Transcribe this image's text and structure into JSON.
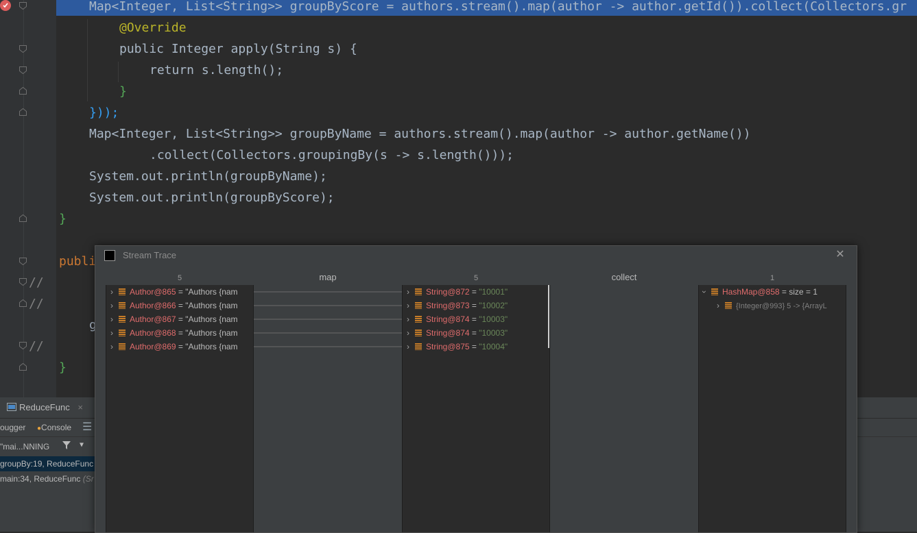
{
  "editor": {
    "lines": [
      {
        "text": "Map<Integer, List<String>> groupByScore = authors.stream().map(author -> author.getId()).collect(Collectors.gr"
      },
      {
        "text": "@Override"
      },
      {
        "text": "public Integer apply(String s) {"
      },
      {
        "text": "return s.length();"
      },
      {
        "text": "}"
      },
      {
        "text": "}));"
      },
      {
        "text": "Map<Integer, List<String>> groupByName = authors.stream().map(author -> author.getName())"
      },
      {
        "text": ".collect(Collectors.groupingBy(s -> s.length()));"
      },
      {
        "text": "System.out.println(groupByName);"
      },
      {
        "text": "System.out.println(groupByScore);"
      },
      {
        "text": "}"
      },
      {
        "text": "publi"
      },
      {
        "text": "//"
      },
      {
        "text": "//"
      },
      {
        "text": "g"
      },
      {
        "text": "//"
      },
      {
        "text": "}"
      }
    ]
  },
  "bottom": {
    "file_tab": "ReduceFunc",
    "debugger_tab": "ougger",
    "console_tab": "Console",
    "thread": "\"mai...NNING",
    "frames": [
      "groupBy:19, ReduceFunc",
      "main:34, ReduceFunc"
    ],
    "frame2_suffix": "(Sr"
  },
  "stream_trace": {
    "title": "Stream Trace",
    "columns": [
      {
        "count": "5",
        "label": ""
      },
      {
        "count": "",
        "label": "map"
      },
      {
        "count": "5",
        "label": ""
      },
      {
        "count": "",
        "label": "collect"
      },
      {
        "count": "1",
        "label": ""
      }
    ],
    "authors": [
      {
        "name": "Author@865",
        "value": "\"Authors {nam"
      },
      {
        "name": "Author@866",
        "value": "\"Authors {nam"
      },
      {
        "name": "Author@867",
        "value": "\"Authors {nam"
      },
      {
        "name": "Author@868",
        "value": "\"Authors {nam"
      },
      {
        "name": "Author@869",
        "value": "\"Authors {nam"
      }
    ],
    "strings": [
      {
        "name": "String@872",
        "value": "\"10001\""
      },
      {
        "name": "String@873",
        "value": "\"10002\""
      },
      {
        "name": "String@874",
        "value": "\"10003\""
      },
      {
        "name": "String@874",
        "value": "\"10003\""
      },
      {
        "name": "String@875",
        "value": "\"10004\""
      }
    ],
    "result": {
      "name": "HashMap@858",
      "size": "size = 1",
      "child": "{Integer@993} 5 -> {ArrayL"
    }
  }
}
